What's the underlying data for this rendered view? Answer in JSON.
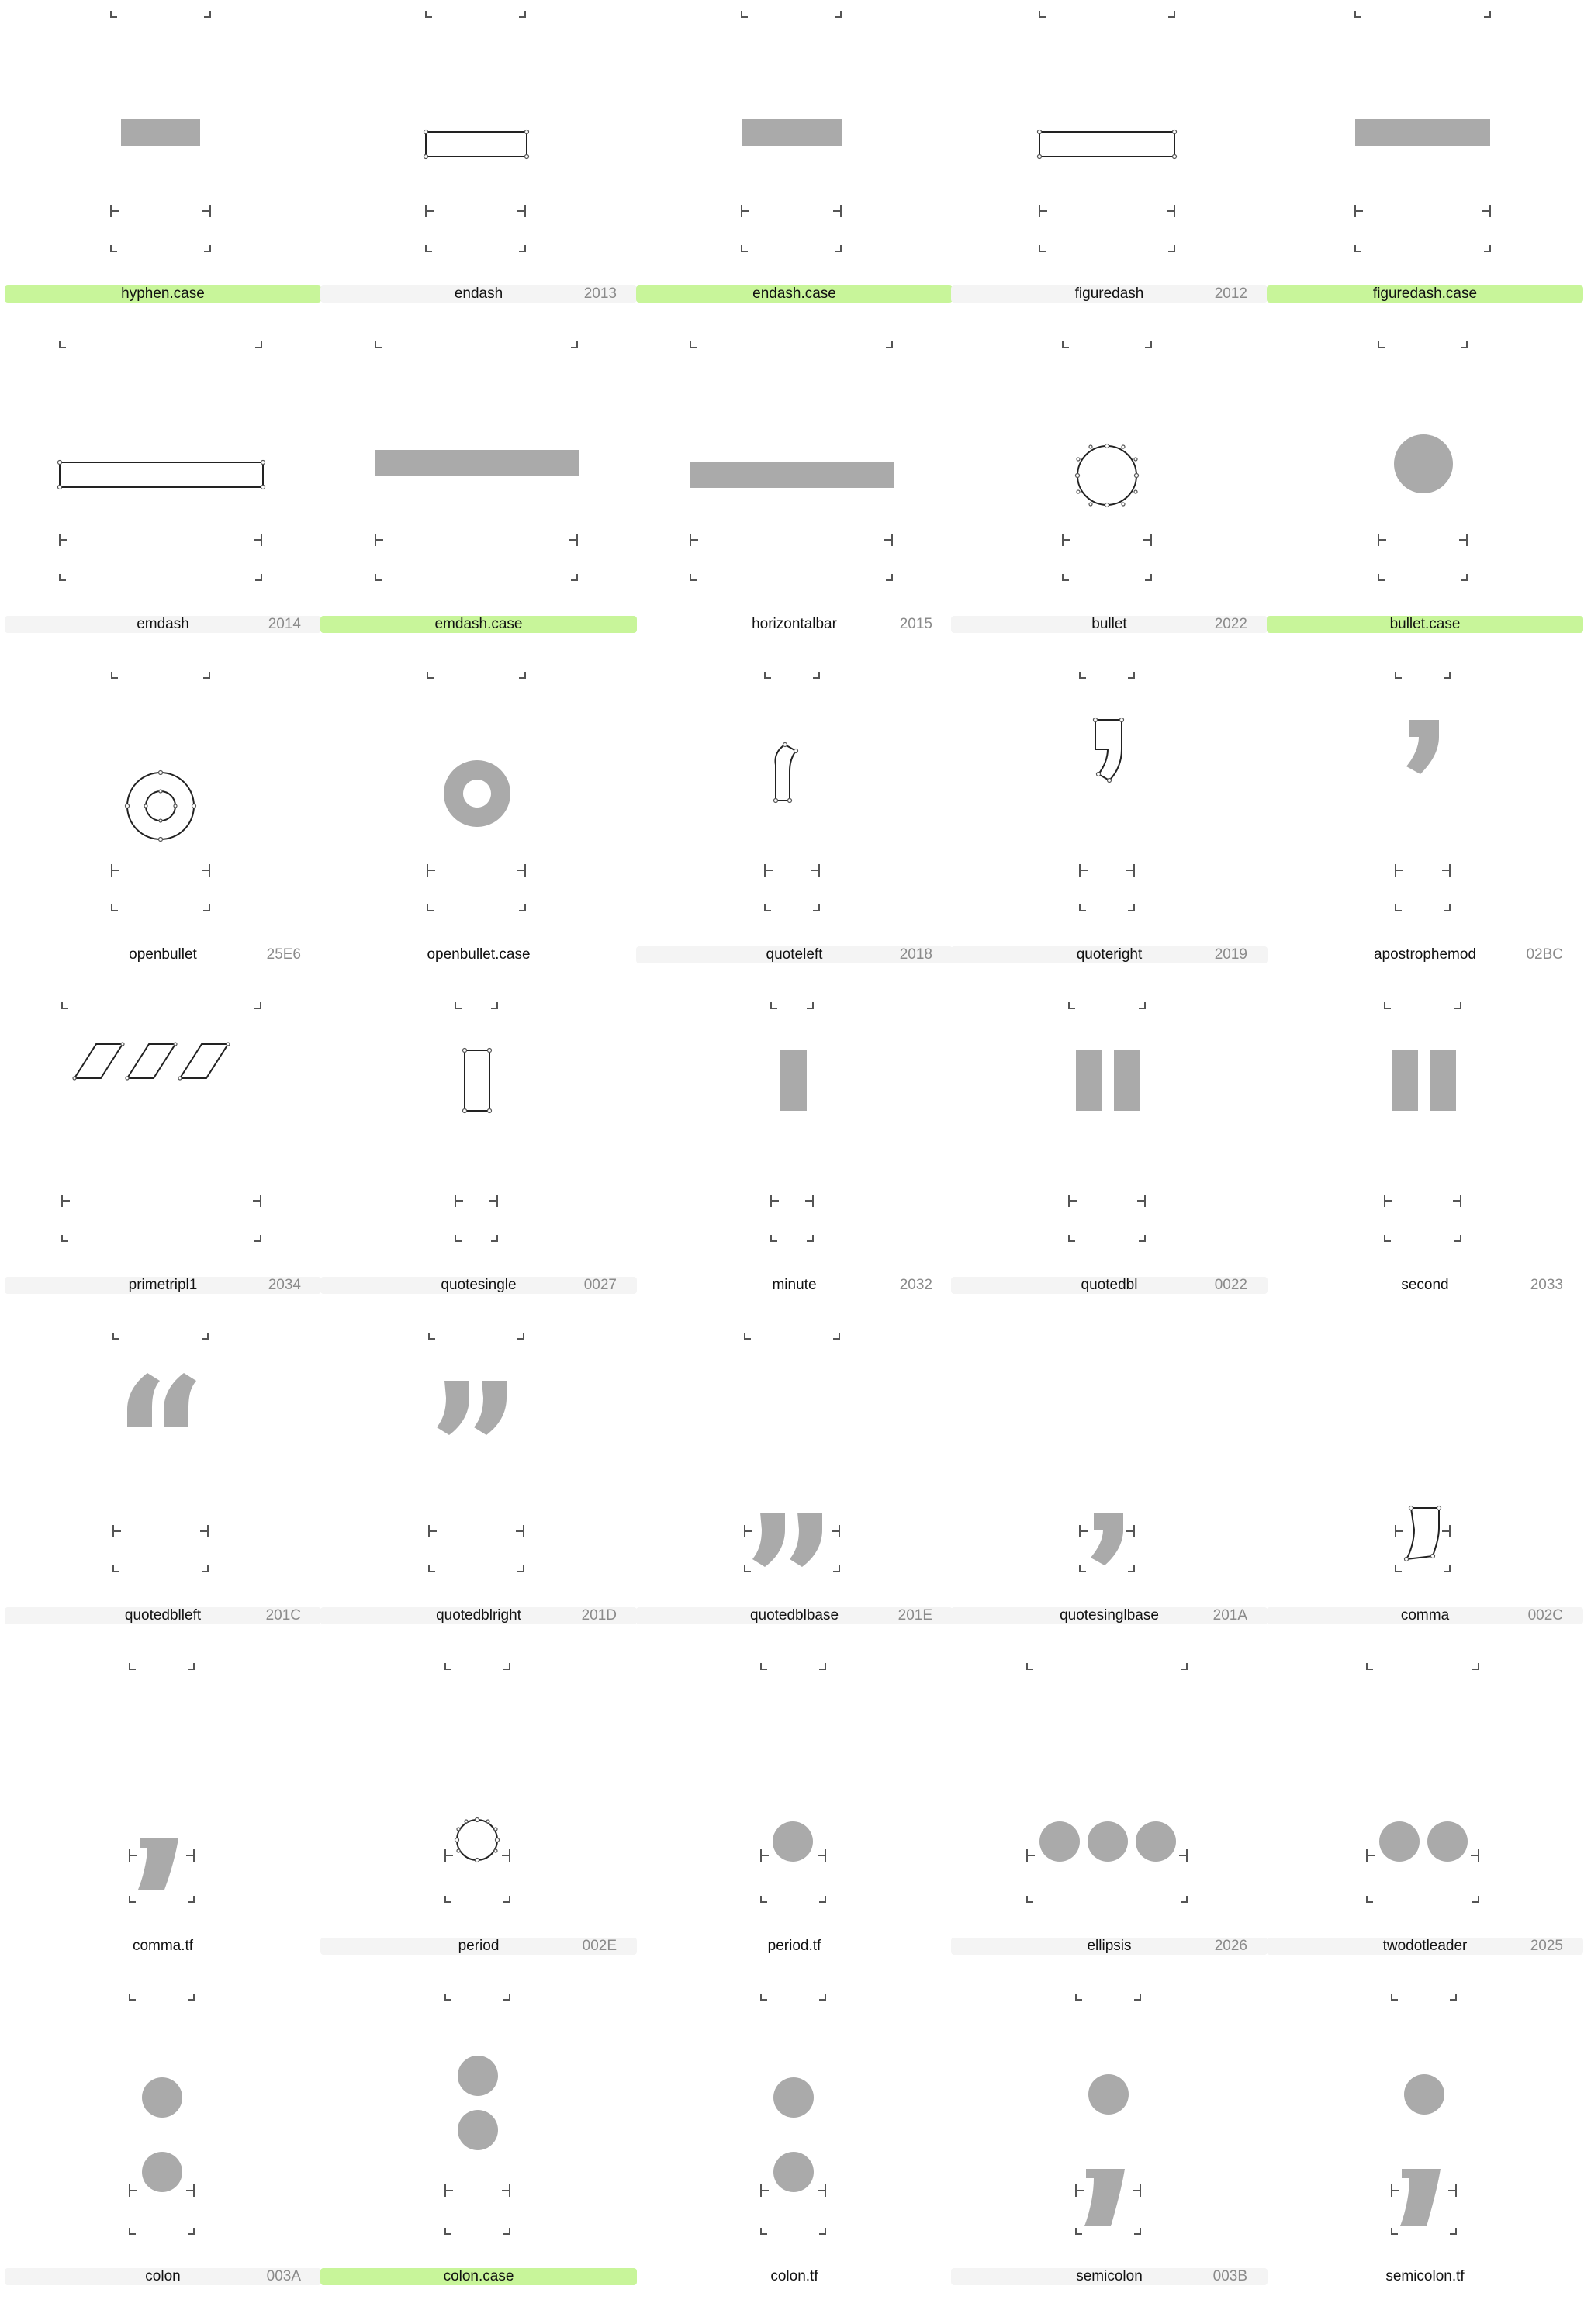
{
  "glyphs": [
    {
      "name": "hyphen.case",
      "code": "",
      "highlight": "green"
    },
    {
      "name": "endash",
      "code": "2013",
      "highlight": "gray"
    },
    {
      "name": "endash.case",
      "code": "",
      "highlight": "green"
    },
    {
      "name": "figuredash",
      "code": "2012",
      "highlight": "gray"
    },
    {
      "name": "figuredash.case",
      "code": "",
      "highlight": "green"
    },
    {
      "name": "emdash",
      "code": "2014",
      "highlight": "gray"
    },
    {
      "name": "emdash.case",
      "code": "",
      "highlight": "green"
    },
    {
      "name": "horizontalbar",
      "code": "2015",
      "highlight": "plain"
    },
    {
      "name": "bullet",
      "code": "2022",
      "highlight": "gray"
    },
    {
      "name": "bullet.case",
      "code": "",
      "highlight": "green"
    },
    {
      "name": "openbullet",
      "code": "25E6",
      "highlight": "plain"
    },
    {
      "name": "openbullet.case",
      "code": "",
      "highlight": "plain"
    },
    {
      "name": "quoteleft",
      "code": "2018",
      "highlight": "gray"
    },
    {
      "name": "quoteright",
      "code": "2019",
      "highlight": "gray"
    },
    {
      "name": "apostrophemod",
      "code": "02BC",
      "highlight": "plain"
    },
    {
      "name": "primetripl1",
      "code": "2034",
      "highlight": "gray"
    },
    {
      "name": "quotesingle",
      "code": "0027",
      "highlight": "gray"
    },
    {
      "name": "minute",
      "code": "2032",
      "highlight": "plain"
    },
    {
      "name": "quotedbl",
      "code": "0022",
      "highlight": "gray"
    },
    {
      "name": "second",
      "code": "2033",
      "highlight": "plain"
    },
    {
      "name": "quotedblleft",
      "code": "201C",
      "highlight": "gray"
    },
    {
      "name": "quotedblright",
      "code": "201D",
      "highlight": "gray"
    },
    {
      "name": "quotedblbase",
      "code": "201E",
      "highlight": "gray"
    },
    {
      "name": "quotesinglbase",
      "code": "201A",
      "highlight": "gray"
    },
    {
      "name": "comma",
      "code": "002C",
      "highlight": "gray"
    },
    {
      "name": "comma.tf",
      "code": "",
      "highlight": "plain"
    },
    {
      "name": "period",
      "code": "002E",
      "highlight": "gray"
    },
    {
      "name": "period.tf",
      "code": "",
      "highlight": "plain"
    },
    {
      "name": "ellipsis",
      "code": "2026",
      "highlight": "gray"
    },
    {
      "name": "twodotleader",
      "code": "2025",
      "highlight": "gray"
    },
    {
      "name": "colon",
      "code": "003A",
      "highlight": "gray"
    },
    {
      "name": "colon.case",
      "code": "",
      "highlight": "green"
    },
    {
      "name": "colon.tf",
      "code": "",
      "highlight": "plain"
    },
    {
      "name": "semicolon",
      "code": "003B",
      "highlight": "gray"
    },
    {
      "name": "semicolon.tf",
      "code": "",
      "highlight": "plain"
    }
  ],
  "colors": {
    "highlight_green": "#c8f59a",
    "label_gray": "#f4f4f4",
    "glyph_fill": "#aaaaaa"
  }
}
